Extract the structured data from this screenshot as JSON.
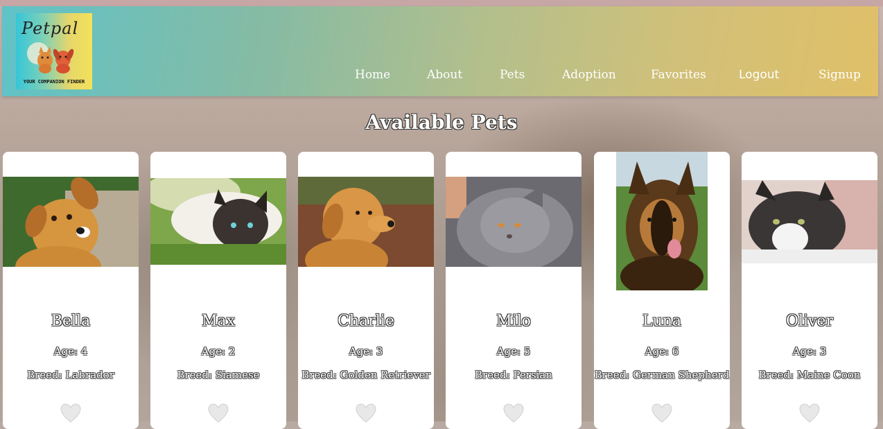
{
  "brand": {
    "logo_script": "Petpal",
    "logo_tagline": "YOUR COMPANION FINDER"
  },
  "nav": {
    "home": "Home",
    "about": "About",
    "pets": "Pets",
    "adoption": "Adoption",
    "favorites": "Favorites",
    "logout": "Logout",
    "signup": "Signup"
  },
  "main": {
    "title": "Available Pets"
  },
  "pets": [
    {
      "name": "Bella",
      "age": "Age: 4",
      "breed": "Breed: Labrador",
      "icon": "heart-icon"
    },
    {
      "name": "Max",
      "age": "Age: 2",
      "breed": "Breed: Siamese",
      "icon": "heart-icon"
    },
    {
      "name": "Charlie",
      "age": "Age: 3",
      "breed": "Breed: Golden Retriever",
      "icon": "heart-icon"
    },
    {
      "name": "Milo",
      "age": "Age: 5",
      "breed": "Breed: Persian",
      "icon": "heart-icon"
    },
    {
      "name": "Luna",
      "age": "Age: 6",
      "breed": "Breed: German Shepherd",
      "icon": "heart-icon"
    },
    {
      "name": "Oliver",
      "age": "Age: 3",
      "breed": "Breed: Maine Coon",
      "icon": "heart-icon"
    }
  ],
  "colors": {
    "header_start": "#5fc3c8",
    "header_end": "#e0c068",
    "card_bg": "#ffffff"
  }
}
